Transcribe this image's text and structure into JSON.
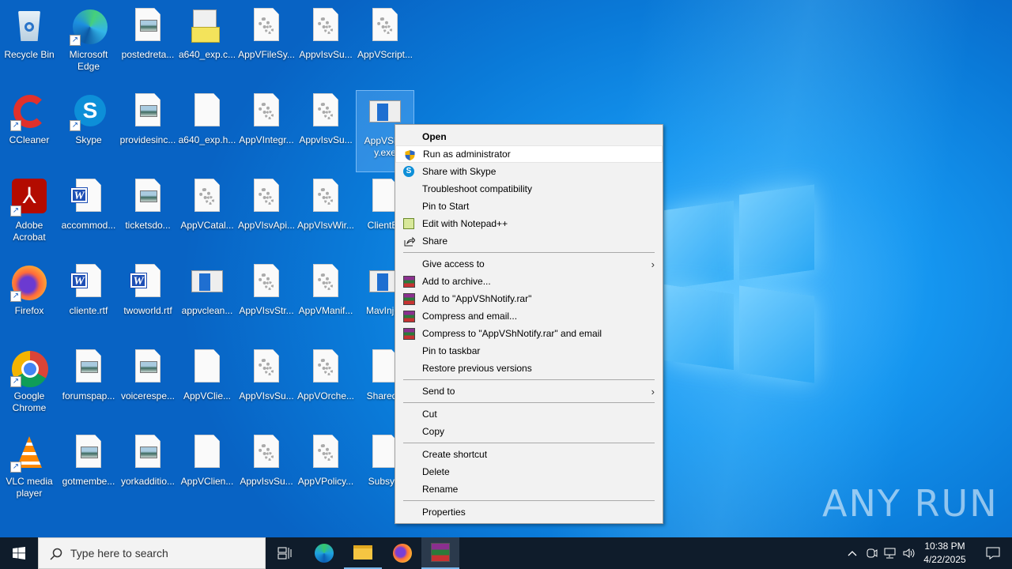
{
  "desktop": {
    "icons": [
      {
        "label": "Recycle Bin",
        "type": "recycle",
        "col": 0,
        "row": 0
      },
      {
        "label": "Microsoft\nEdge",
        "type": "edge",
        "col": 1,
        "row": 0,
        "shortcut": true
      },
      {
        "label": "postedreta...",
        "type": "image",
        "col": 2,
        "row": 0
      },
      {
        "label": "a640_exp.c...",
        "type": "archive",
        "col": 3,
        "row": 0
      },
      {
        "label": "AppVFileSy...",
        "type": "gear",
        "col": 4,
        "row": 0
      },
      {
        "label": "AppvIsvSu...",
        "type": "gear",
        "col": 5,
        "row": 0
      },
      {
        "label": "AppVScript...",
        "type": "gear",
        "col": 6,
        "row": 0
      },
      {
        "label": "CCleaner",
        "type": "ccleaner",
        "col": 0,
        "row": 1,
        "shortcut": true
      },
      {
        "label": "Skype",
        "type": "skype",
        "col": 1,
        "row": 1,
        "shortcut": true
      },
      {
        "label": "providesinc...",
        "type": "image",
        "col": 2,
        "row": 1
      },
      {
        "label": "a640_exp.h...",
        "type": "blank",
        "col": 3,
        "row": 1
      },
      {
        "label": "AppVIntegr...",
        "type": "gear",
        "col": 4,
        "row": 1
      },
      {
        "label": "AppvIsvSu...",
        "type": "gear",
        "col": 5,
        "row": 1
      },
      {
        "label": "AppVShN\ny.exe",
        "type": "app",
        "col": 6,
        "row": 1,
        "selected": true
      },
      {
        "label": "Adobe\nAcrobat",
        "type": "acrobat",
        "col": 0,
        "row": 2,
        "shortcut": true
      },
      {
        "label": "accommod...",
        "type": "word",
        "col": 1,
        "row": 2
      },
      {
        "label": "ticketsdo...",
        "type": "image",
        "col": 2,
        "row": 2
      },
      {
        "label": "AppVCatal...",
        "type": "gear",
        "col": 3,
        "row": 2
      },
      {
        "label": "AppVIsvApi...",
        "type": "gear",
        "col": 4,
        "row": 2
      },
      {
        "label": "AppVIsvWir...",
        "type": "gear",
        "col": 5,
        "row": 2
      },
      {
        "label": "ClientEv",
        "type": "blank",
        "col": 6,
        "row": 2
      },
      {
        "label": "Firefox",
        "type": "firefox",
        "col": 0,
        "row": 3,
        "shortcut": true
      },
      {
        "label": "cliente.rtf",
        "type": "word",
        "col": 1,
        "row": 3
      },
      {
        "label": "twoworld.rtf",
        "type": "word",
        "col": 2,
        "row": 3
      },
      {
        "label": "appvclean...",
        "type": "app",
        "col": 3,
        "row": 3
      },
      {
        "label": "AppVIsvStr...",
        "type": "gear",
        "col": 4,
        "row": 3
      },
      {
        "label": "AppVManif...",
        "type": "gear",
        "col": 5,
        "row": 3
      },
      {
        "label": "MavInjec",
        "type": "app",
        "col": 6,
        "row": 3
      },
      {
        "label": "Google\nChrome",
        "type": "chrome",
        "col": 0,
        "row": 4,
        "shortcut": true
      },
      {
        "label": "forumspap...",
        "type": "image",
        "col": 1,
        "row": 4
      },
      {
        "label": "voicerespe...",
        "type": "image",
        "col": 2,
        "row": 4
      },
      {
        "label": "AppVClie...",
        "type": "blank",
        "col": 3,
        "row": 4
      },
      {
        "label": "AppVIsvSu...",
        "type": "gear",
        "col": 4,
        "row": 4
      },
      {
        "label": "AppVOrche...",
        "type": "gear",
        "col": 5,
        "row": 4
      },
      {
        "label": "SharedP",
        "type": "blank",
        "col": 6,
        "row": 4
      },
      {
        "label": "VLC media\nplayer",
        "type": "vlc",
        "col": 0,
        "row": 5,
        "shortcut": true
      },
      {
        "label": "gotmembe...",
        "type": "image",
        "col": 1,
        "row": 5
      },
      {
        "label": "yorkadditio...",
        "type": "image",
        "col": 2,
        "row": 5
      },
      {
        "label": "AppVClien...",
        "type": "blank",
        "col": 3,
        "row": 5
      },
      {
        "label": "AppvIsvSu...",
        "type": "gear",
        "col": 4,
        "row": 5
      },
      {
        "label": "AppVPolicy...",
        "type": "gear",
        "col": 5,
        "row": 5
      },
      {
        "label": "Subsyst",
        "type": "blank",
        "col": 6,
        "row": 5
      }
    ]
  },
  "context_menu": {
    "items": [
      {
        "label": "Open",
        "bold": true
      },
      {
        "label": "Run as administrator",
        "icon": "shield",
        "highlight": true
      },
      {
        "label": "Share with Skype",
        "icon": "skype"
      },
      {
        "label": "Troubleshoot compatibility"
      },
      {
        "label": "Pin to Start"
      },
      {
        "label": "Edit with Notepad++",
        "icon": "notepadpp"
      },
      {
        "label": "Share",
        "icon": "share"
      },
      {
        "sep": true
      },
      {
        "label": "Give access to",
        "submenu": true
      },
      {
        "label": "Add to archive...",
        "icon": "winrar"
      },
      {
        "label": "Add to \"AppVShNotify.rar\"",
        "icon": "winrar"
      },
      {
        "label": "Compress and email...",
        "icon": "winrar"
      },
      {
        "label": "Compress to \"AppVShNotify.rar\" and email",
        "icon": "winrar"
      },
      {
        "label": "Pin to taskbar"
      },
      {
        "label": "Restore previous versions"
      },
      {
        "sep": true
      },
      {
        "label": "Send to",
        "submenu": true
      },
      {
        "sep": true
      },
      {
        "label": "Cut"
      },
      {
        "label": "Copy"
      },
      {
        "sep": true
      },
      {
        "label": "Create shortcut"
      },
      {
        "label": "Delete"
      },
      {
        "label": "Rename"
      },
      {
        "sep": true
      },
      {
        "label": "Properties"
      }
    ]
  },
  "taskbar": {
    "search_placeholder": "Type here to search",
    "time": "10:38 PM",
    "date": "4/22/2025"
  },
  "watermark": "ANY RUN"
}
